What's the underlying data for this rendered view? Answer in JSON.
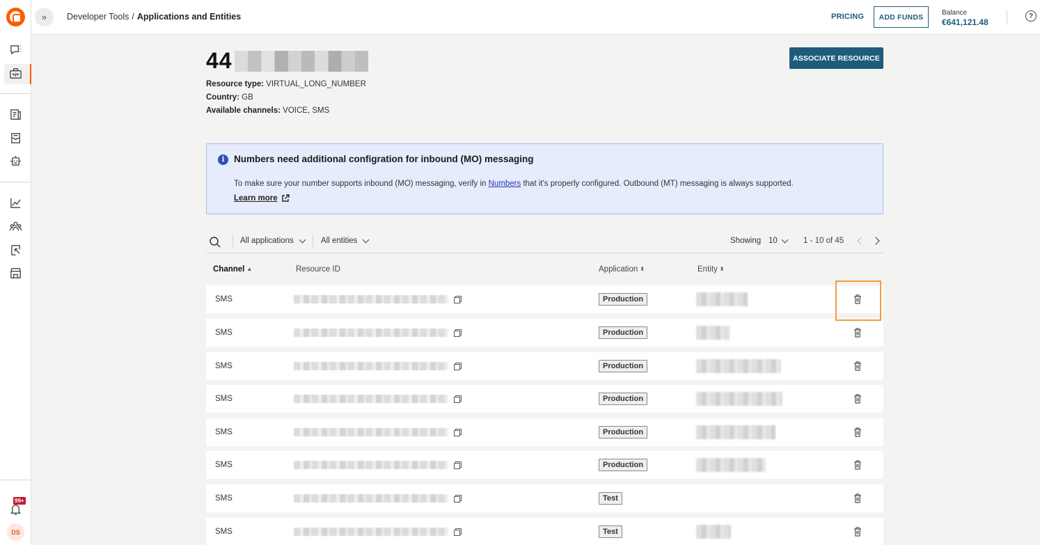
{
  "topbar": {
    "breadcrumb_parent": "Developer Tools",
    "breadcrumb_separator": "/",
    "breadcrumb_current": "Applications and Entities",
    "pricing_label": "PRICING",
    "add_funds_label": "ADD FUNDS",
    "balance_label": "Balance",
    "balance_value": "€641,121.48"
  },
  "sidebar": {
    "notification_badge": "99+",
    "avatar_initials": "DS",
    "icons": [
      "chat-icon",
      "developer-tools-icon",
      "documents-icon",
      "inbox-icon",
      "bot-icon",
      "analytics-icon",
      "people-icon",
      "exports-icon",
      "store-icon",
      "bell-icon"
    ]
  },
  "resource": {
    "number_prefix": "44",
    "associate_button": "ASSOCIATE RESOURCE",
    "type_label": "Resource type:",
    "type_value": "VIRTUAL_LONG_NUMBER",
    "country_label": "Country:",
    "country_value": "GB",
    "channels_label": "Available channels:",
    "channels_value": "VOICE, SMS"
  },
  "notice": {
    "title": "Numbers need additional configration for inbound (MO) messaging",
    "text_before": "To make sure your number supports inbound (MO) messaging, verify in ",
    "link": "Numbers",
    "text_after": " that it's properly configured. Outbound (MT) messaging is always supported.",
    "learn_more": "Learn more"
  },
  "filters": {
    "applications": "All applications",
    "entities": "All entities",
    "showing_label": "Showing",
    "page_size": "10",
    "range": "1 - 10 of 45"
  },
  "table": {
    "headers": {
      "channel": "Channel",
      "resource_id": "Resource ID",
      "application": "Application",
      "entity": "Entity"
    },
    "rows": [
      {
        "channel": "SMS",
        "application": "Production"
      },
      {
        "channel": "SMS",
        "application": "Production"
      },
      {
        "channel": "SMS",
        "application": "Production"
      },
      {
        "channel": "SMS",
        "application": "Production"
      },
      {
        "channel": "SMS",
        "application": "Production"
      },
      {
        "channel": "SMS",
        "application": "Production"
      },
      {
        "channel": "SMS",
        "application": "Test"
      },
      {
        "channel": "SMS",
        "application": "Test"
      }
    ]
  },
  "colors": {
    "accent": "#1d5d7a",
    "brand": "#ff5a00",
    "notice_bg": "#e6ecfb",
    "highlight": "#f39c3a"
  }
}
